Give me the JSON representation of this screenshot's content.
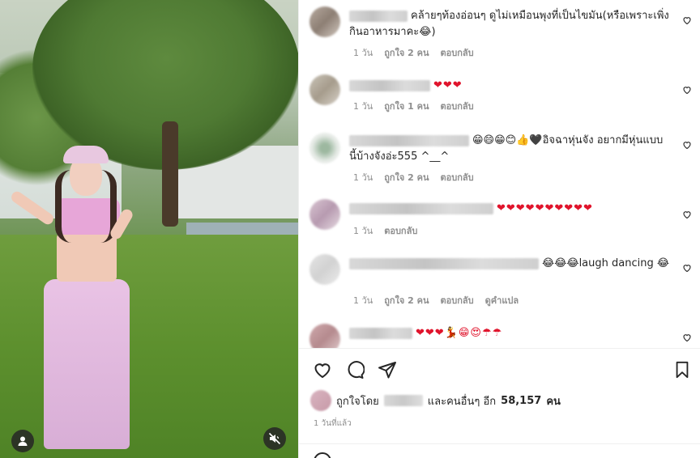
{
  "media": {
    "user_icon": "user-icon",
    "mute_icon": "speaker-muted-icon"
  },
  "comments": [
    {
      "text": "คล้ายๆท้องอ่อนๆ ดูไม่เหมือนพุงที่เป็นไขมัน(หรือเพราะเพิ่งกินอาหารมาคะ😂)",
      "time": "1 วัน",
      "likes": "ถูกใจ 2 คน",
      "reply": "ตอบกลับ",
      "translate": ""
    },
    {
      "text": "❤❤❤",
      "time": "1 วัน",
      "likes": "ถูกใจ 1 คน",
      "reply": "ตอบกลับ",
      "translate": ""
    },
    {
      "text": "😁😄😁😊👍🖤อิจฉาหุ่นจัง อยากมีหุ่นแบบนี้บ้างจังอ่ะ555 ^__^",
      "time": "1 วัน",
      "likes": "ถูกใจ 2 คน",
      "reply": "ตอบกลับ",
      "translate": ""
    },
    {
      "text": "❤❤❤❤❤❤❤❤❤❤",
      "time": "1 วัน",
      "likes": "",
      "reply": "ตอบกลับ",
      "translate": ""
    },
    {
      "text": "😂😂😂laugh dancing 😂",
      "time": "1 วัน",
      "likes": "ถูกใจ 2 คน",
      "reply": "ตอบกลับ",
      "translate": "ดูคำแปล"
    },
    {
      "text": "❤❤❤💃😁😍☂☂",
      "time": "",
      "likes": "",
      "reply": "",
      "translate": ""
    }
  ],
  "actions": {
    "like_icon": "heart-icon",
    "comment_icon": "comment-bubble-icon",
    "share_icon": "paper-plane-icon",
    "save_icon": "bookmark-icon"
  },
  "liked_by": {
    "prefix": "ถูกใจโดย",
    "middle": "และคนอื่นๆ อีก",
    "count": "58,157",
    "suffix": "คน"
  },
  "time_ago": "1 วันที่แล้ว"
}
